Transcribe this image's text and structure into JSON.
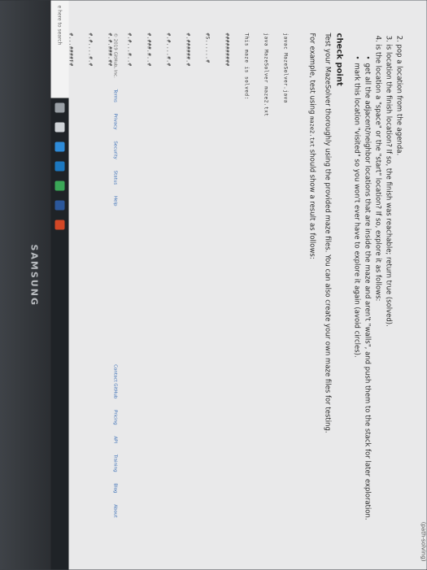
{
  "header": {
    "top_cut": "(path-solving)"
  },
  "steps": [
    "pop a location from the agenda.",
    "is location the finish location? If so, the finish was reachable; return true (solved).",
    "is the location a \"space\" or the \"start\" location? If so, explore it as follows:"
  ],
  "substeps": [
    "get all the adjacent/neighbor locations that are inside the maze and aren't \"walls\", and push them to the stack for later exploration.",
    "mark this location \"visited\" so you won't ever have to explore it again (avoid circles)."
  ],
  "checkpoint": {
    "title": "check point",
    "para1": "Test your MazeSolver thoroughly using the provided maze files. You can also create your own maze files for testing.",
    "para2_pre": "For example, test using ",
    "para2_code": "maze2.txt",
    "para2_post": " should show a result as follows:",
    "code_lines": [
      "javac MazeSolver.java",
      "java MazeSolver maze2.txt",
      "This maze is solved:"
    ],
    "maze_rows": [
      "##########",
      "#S......#",
      "#.######.#",
      "#.#....#.#",
      "#.###.#..#",
      "#.#...#..#",
      "#.#.###.##",
      "#.#....#.#",
      "#...####F#",
      "##########"
    ]
  },
  "footer": {
    "copyright": "© 2019 GitHub, Inc.",
    "links": [
      "Terms",
      "Privacy",
      "Security",
      "Status",
      "Help"
    ],
    "right_links": [
      "Contact GitHub",
      "Pricing",
      "API",
      "Training",
      "Blog",
      "About"
    ]
  },
  "taskbar": {
    "search_placeholder": "e here to search"
  },
  "bezel": {
    "brand": "SAMSUNG"
  }
}
